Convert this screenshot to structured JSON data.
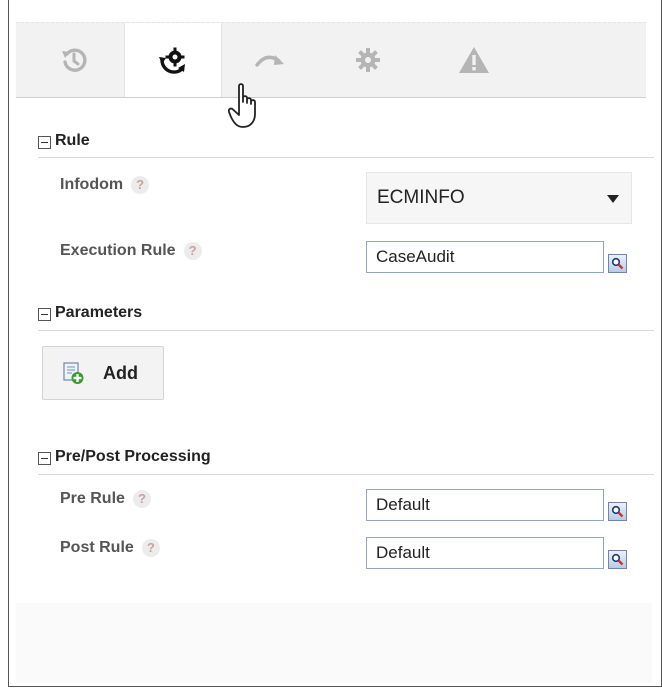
{
  "toolbar": {
    "buttons": [
      {
        "name": "history-icon",
        "active": false
      },
      {
        "name": "refresh-settings-icon",
        "active": true
      },
      {
        "name": "redo-arrow-icon",
        "active": false
      },
      {
        "name": "gear-icon",
        "active": false
      },
      {
        "name": "warning-icon",
        "active": false
      }
    ]
  },
  "rule_section": {
    "title": "Rule",
    "infodom_label": "Infodom",
    "infodom_value": "ECMINFO",
    "execution_rule_label": "Execution Rule",
    "execution_rule_value": "CaseAudit",
    "help_glyph": "?"
  },
  "parameters_section": {
    "title": "Parameters",
    "add_label": "Add"
  },
  "processing_section": {
    "title": "Pre/Post Processing",
    "pre_rule_label": "Pre Rule",
    "pre_rule_value": "Default",
    "post_rule_label": "Post Rule",
    "post_rule_value": "Default"
  },
  "colors": {
    "toolbar_bg": "#f2f2f2",
    "icon_gray": "#b5b5b5",
    "icon_dark": "#111111",
    "input_border": "#8fa6c4"
  }
}
